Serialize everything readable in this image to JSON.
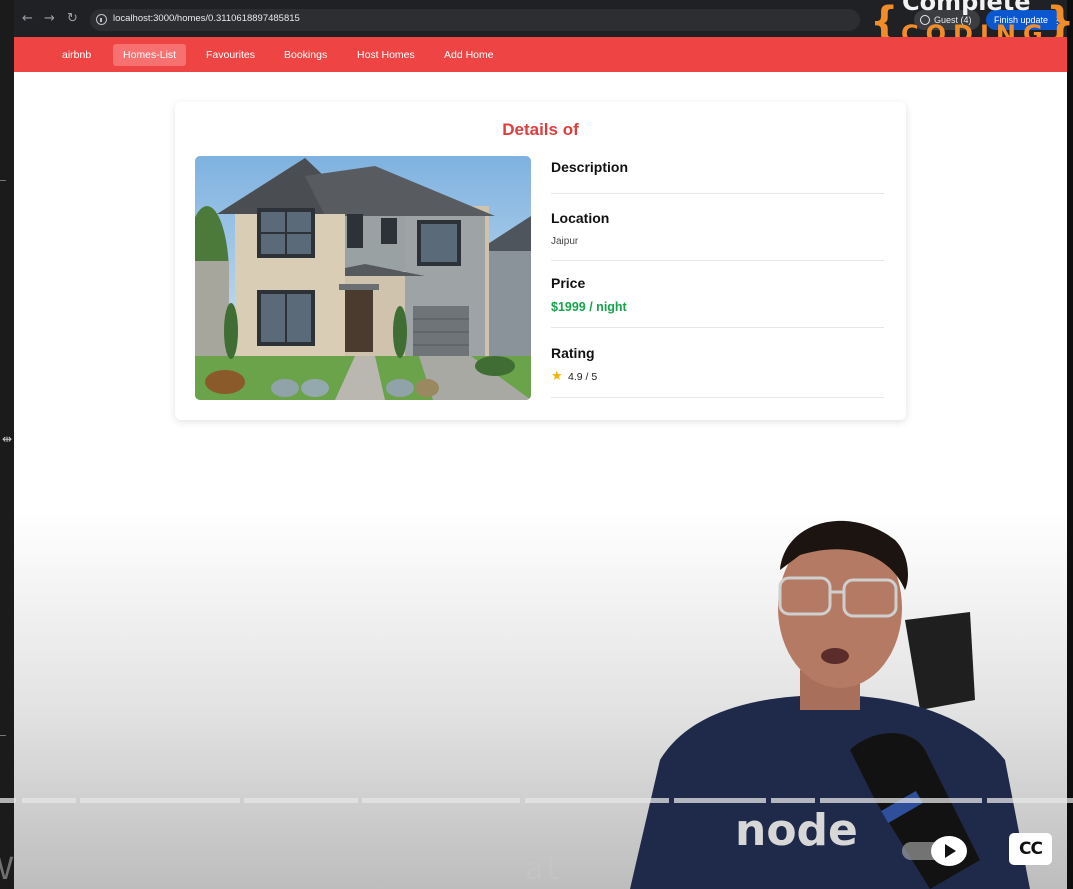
{
  "browser": {
    "url": "localhost:3000/homes/0.3110618897485815",
    "profile_label": "Guest (4)",
    "update_label": "Finish update",
    "menu_glyph": "⋮"
  },
  "watermark": {
    "top_text": "Complete",
    "word": "CODING",
    "brace_open": "{",
    "brace_close": "}"
  },
  "navbar": {
    "items": [
      {
        "label": "airbnb",
        "active": false
      },
      {
        "label": "Homes-List",
        "active": true
      },
      {
        "label": "Favourites",
        "active": false
      },
      {
        "label": "Bookings",
        "active": false
      },
      {
        "label": "Host Homes",
        "active": false
      },
      {
        "label": "Add Home",
        "active": false
      }
    ]
  },
  "card": {
    "title": "Details of",
    "description_label": "Description",
    "location_label": "Location",
    "location_value": "Jaipur",
    "price_label": "Price",
    "price_value": "$1999 / night",
    "rating_label": "Rating",
    "rating_value": "4.9 / 5",
    "star_icon": "★"
  },
  "player": {
    "cc_label": "CC",
    "ghost_text": "al",
    "ghost_text_left": "V"
  },
  "colors": {
    "navbar": "#ef4444",
    "active_nav": "#f87171",
    "title": "#dc3e3e",
    "price": "#16a34a",
    "star": "#f5b301"
  }
}
